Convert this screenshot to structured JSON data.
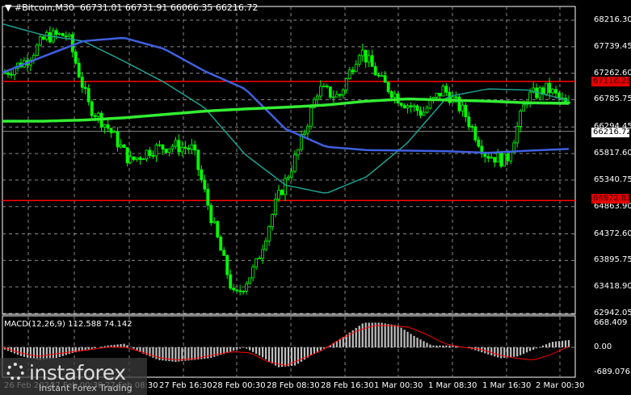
{
  "header": {
    "symbol": "#Bitcoin,M30",
    "open": "66731.01",
    "high": "66731.91",
    "low": "66066.35",
    "close": "66216.72"
  },
  "price_axis": [
    "68216.30",
    "67739.45",
    "67262.60",
    "66785.75",
    "66294.45",
    "65817.60",
    "65340.75",
    "64863.90",
    "64372.60",
    "63895.75",
    "63418.90",
    "62942.05"
  ],
  "levels": {
    "upper": "67116.28",
    "lower": "64972.81",
    "current": "66216.72"
  },
  "macd": {
    "label": "MACD(12,26,9) 112.588 74.142",
    "axis": [
      "668.409",
      "0.00",
      "-689.076"
    ]
  },
  "time_axis": [
    "26 Feb 2024",
    "27 Feb 00:30",
    "27 Feb 08:30",
    "27 Feb 16:30",
    "28 Feb 00:30",
    "28 Feb 08:30",
    "28 Feb 16:30",
    "1 Mar 00:30",
    "1 Mar 08:30",
    "1 Mar 16:30",
    "2 Mar 00:30"
  ],
  "watermark": {
    "brand": "instaforex",
    "tagline": "Instant Forex Trading"
  },
  "colors": {
    "bull": "#00ff00",
    "level": "#ff0000",
    "ma_fast": "#4060e0",
    "ma_slow": "#20a090",
    "ma_long": "#33ee33",
    "hist": "#c0c0c0",
    "signal": "#ff0000"
  },
  "chart_data": {
    "type": "candlestick",
    "price_path": [
      67272,
      67490,
      67926,
      67950,
      66691,
      66255,
      65674,
      65892,
      65964,
      65900,
      64511,
      63204,
      63785,
      64947,
      65819,
      66981,
      66836,
      67708,
      67126,
      66763,
      66545,
      66981,
      66545,
      65819,
      65674,
      66836,
      66981,
      66647
    ],
    "ma_long": [
      66400,
      66400,
      66420,
      66460,
      66520,
      66580,
      66620,
      66650,
      66690,
      66760,
      66800,
      66780,
      66760,
      66730,
      66720
    ],
    "ma_fast": [
      67272,
      67560,
      67840,
      67900,
      67700,
      67300,
      66980,
      66260,
      65940,
      65880,
      65870,
      65860,
      65830,
      65870,
      65900
    ],
    "ma_slow": [
      68150,
      67950,
      67840,
      67480,
      67100,
      66640,
      65800,
      65250,
      65100,
      65400,
      66000,
      66840,
      66980,
      66960,
      66770
    ],
    "macd_hist": [
      -60,
      -250,
      -350,
      -300,
      -150,
      -50,
      50,
      100,
      -150,
      -350,
      -400,
      -350,
      -300,
      -150,
      0,
      -250,
      -550,
      -500,
      -200,
      50,
      350,
      680,
      680,
      600,
      300,
      50,
      50,
      0,
      -150,
      -300,
      -250,
      -50,
      150,
      200
    ],
    "macd_signal": [
      0,
      -150,
      -250,
      -180,
      -120,
      -60,
      10,
      0,
      -150,
      -300,
      -350,
      -300,
      -200,
      -120,
      -150,
      -400,
      -500,
      -300,
      -100,
      200,
      450,
      600,
      600,
      550,
      350,
      100,
      0,
      -50,
      -200,
      -300,
      -350,
      -200,
      30
    ]
  }
}
